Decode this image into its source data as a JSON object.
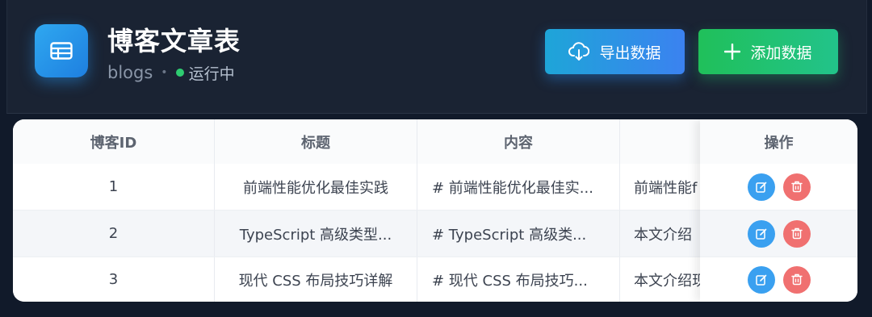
{
  "header": {
    "title": "博客文章表",
    "table_name": "blogs",
    "separator": "•",
    "status": "运行中",
    "export_label": "导出数据",
    "add_label": "添加数据"
  },
  "table": {
    "columns": [
      "博客ID",
      "标题",
      "内容",
      "",
      "操作"
    ],
    "rows": [
      {
        "id": "1",
        "title": "前端性能优化最佳实践",
        "content": "# 前端性能优化最佳实...",
        "summary": "前端性能f"
      },
      {
        "id": "2",
        "title": "TypeScript 高级类型...",
        "content": "# TypeScript 高级类...",
        "summary": "本文介绍"
      },
      {
        "id": "3",
        "title": "现代 CSS 布局技巧详解",
        "content": "# 现代 CSS 布局技巧...",
        "summary": "本文介绍现"
      }
    ]
  },
  "icons": {
    "app": "table-icon",
    "export": "cloud-download-icon",
    "add": "plus-icon",
    "edit": "edit-icon",
    "delete": "trash-icon"
  },
  "colors": {
    "background": "#111a2a",
    "export_button": "#3b82f0",
    "add_button": "#20c05a",
    "status_dot": "#2ecc71",
    "edit": "#3aa0f0",
    "delete": "#f07070"
  }
}
